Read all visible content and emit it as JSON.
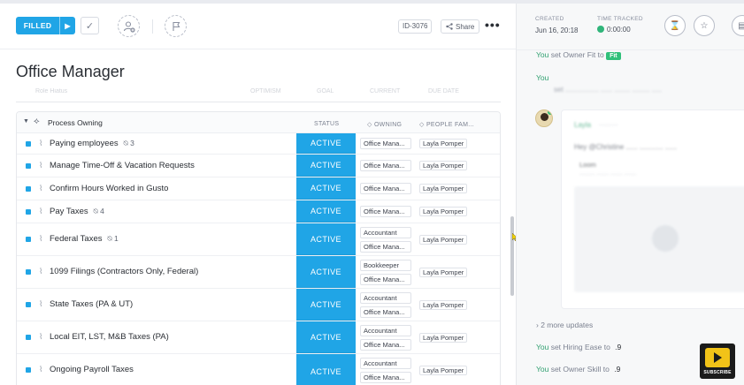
{
  "toolbar": {
    "status_label": "FILLED",
    "task_id": "ID-3076",
    "share_label": "Share",
    "more_label": "•••"
  },
  "title": "Office Manager",
  "faded_header": {
    "name": "Role Hiatus",
    "cols": [
      "OPTIMISM",
      "GOAL",
      "CURRENT",
      "DUE DATE"
    ]
  },
  "group": {
    "title": "Process Owning",
    "columns": {
      "status": "STATUS",
      "owning": "OWNING",
      "people": "PEOPLE FAM..."
    }
  },
  "rows": [
    {
      "name": "Paying employees",
      "count": "3",
      "status": "ACTIVE",
      "tags": [
        "Office Mana..."
      ],
      "person": "Layla Pomper"
    },
    {
      "name": "Manage Time-Off & Vacation Requests",
      "count": "",
      "status": "ACTIVE",
      "tags": [
        "Office Mana..."
      ],
      "person": "Layla Pomper"
    },
    {
      "name": "Confirm Hours Worked in Gusto",
      "count": "",
      "status": "ACTIVE",
      "tags": [
        "Office Mana..."
      ],
      "person": "Layla Pomper"
    },
    {
      "name": "Pay Taxes",
      "count": "4",
      "status": "ACTIVE",
      "tags": [
        "Office Mana..."
      ],
      "person": "Layla Pomper"
    },
    {
      "name": "Federal Taxes",
      "count": "1",
      "status": "ACTIVE",
      "tags": [
        "Accountant",
        "Office Mana..."
      ],
      "person": "Layla Pomper"
    },
    {
      "name": "1099 Filings (Contractors Only, Federal)",
      "count": "",
      "status": "ACTIVE",
      "tags": [
        "Bookkeeper",
        "Office Mana..."
      ],
      "person": "Layla Pomper"
    },
    {
      "name": "State Taxes (PA & UT)",
      "count": "",
      "status": "ACTIVE",
      "tags": [
        "Accountant",
        "Office Mana..."
      ],
      "person": "Layla Pomper"
    },
    {
      "name": "Local EIT, LST, M&B Taxes (PA)",
      "count": "",
      "status": "ACTIVE",
      "tags": [
        "Accountant",
        "Office Mana..."
      ],
      "person": "Layla Pomper"
    },
    {
      "name": "Ongoing Payroll Taxes",
      "count": "",
      "status": "ACTIVE",
      "tags": [
        "Accountant",
        "Office Mana..."
      ],
      "person": "Layla Pomper"
    }
  ],
  "right": {
    "created_label": "CREATED",
    "created_value": "Jun 16, 20:18",
    "time_label": "TIME TRACKED",
    "time_value": "0:00:00",
    "activity1": {
      "you": "You",
      "text": " set Owner Fit to ",
      "pill": "Fit"
    },
    "activity2": {
      "you": "You",
      "text": "set ................. ......  ........ ......... ....."
    },
    "comment_author": "Layla",
    "comment_time": "...........",
    "comment_text": "Hey @Christine ......  ............ ......",
    "comment_sub": "Loom",
    "comment_sub2": "......... ....... ....... .......",
    "more_updates": "2 more updates",
    "activity3": {
      "you": "You",
      "text": " set Hiring Ease to ",
      "val": ".9"
    },
    "activity4": {
      "you": "You",
      "text": " set Owner Skill to ",
      "val": ".9"
    },
    "subscribe": "SUBSCRIBE"
  },
  "colors": {
    "accent": "#20a5e6",
    "green": "#30c07a"
  }
}
